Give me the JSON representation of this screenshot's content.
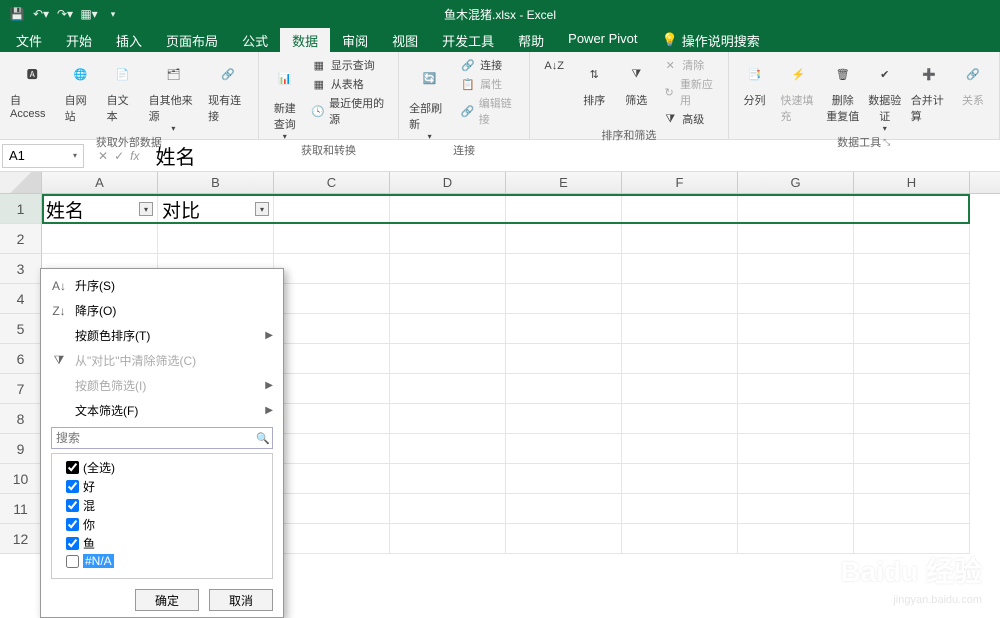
{
  "title": "鱼木混猪.xlsx - Excel",
  "tabs": [
    "文件",
    "开始",
    "插入",
    "页面布局",
    "公式",
    "数据",
    "审阅",
    "视图",
    "开发工具",
    "帮助",
    "Power Pivot"
  ],
  "activeTab": 5,
  "tellme": "操作说明搜索",
  "ribbon": {
    "g1": {
      "label": "获取外部数据",
      "items": [
        "自 Access",
        "自网站",
        "自文本",
        "自其他来源",
        "现有连接"
      ]
    },
    "g2": {
      "label": "获取和转换",
      "main": "新建\n查询",
      "side": [
        "显示查询",
        "从表格",
        "最近使用的源"
      ]
    },
    "g3": {
      "label": "连接",
      "main": "全部刷新",
      "side": [
        "连接",
        "属性",
        "编辑链接"
      ]
    },
    "g4": {
      "label": "排序和筛选",
      "items": [
        "排序",
        "筛选"
      ],
      "side": [
        "清除",
        "重新应用",
        "高级"
      ]
    },
    "g5": {
      "label": "数据工具",
      "items": [
        "分列",
        "快速填充",
        "删除\n重复值",
        "数据验\n证",
        "合并计算",
        "关系"
      ]
    }
  },
  "namebox": "A1",
  "formula": "姓名",
  "columns": [
    "A",
    "B",
    "C",
    "D",
    "E",
    "F",
    "G",
    "H"
  ],
  "rows": [
    "1",
    "2",
    "3",
    "4",
    "5",
    "6",
    "7",
    "8",
    "9",
    "10",
    "11",
    "12"
  ],
  "A1": "姓名",
  "B1": "对比",
  "filterMenu": {
    "sortAsc": "升序(S)",
    "sortDesc": "降序(O)",
    "sortColor": "按颜色排序(T)",
    "clear": "从\"对比\"中清除筛选(C)",
    "filterColor": "按颜色筛选(I)",
    "textFilter": "文本筛选(F)",
    "searchPlaceholder": "搜索",
    "items": [
      {
        "label": "(全选)",
        "checked": true,
        "tristate": true
      },
      {
        "label": "好",
        "checked": true
      },
      {
        "label": "混",
        "checked": true
      },
      {
        "label": "你",
        "checked": true
      },
      {
        "label": "鱼",
        "checked": true
      },
      {
        "label": "#N/A",
        "checked": false,
        "highlight": true
      }
    ],
    "ok": "确定",
    "cancel": "取消"
  },
  "watermark": "Baidu 经验",
  "watermark2": "jingyan.baidu.com"
}
